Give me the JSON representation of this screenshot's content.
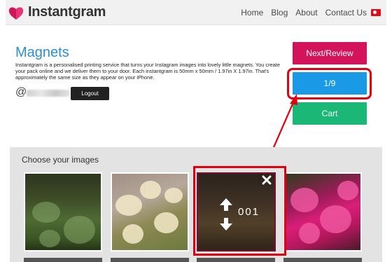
{
  "header": {
    "brand": "Instantgram",
    "nav": [
      "Home",
      "Blog",
      "About",
      "Contact Us"
    ],
    "flag_icon": "turkey-flag-icon"
  },
  "intro": {
    "title": "Magnets",
    "description": "Instantgram is a personalised printing service that turns your Instagram images into lovely little magnets. You create your pack online and we deliver them to your door. Each instantgram is 50mm x 50mm / 1.97in X 1.97in. That's approximately the same size as they appear on your iPhone.",
    "at_symbol": "@",
    "logout_label": "Logout"
  },
  "actions": {
    "next_label": "Next/Review",
    "count_label": "1/9",
    "cart_label": "Cart"
  },
  "gallery": {
    "title": "Choose your images",
    "selected_counter": "001"
  },
  "colors": {
    "brand_pink": "#d3145a",
    "blue": "#1a9ae6",
    "green": "#1bb776",
    "title_blue": "#2a8fd3",
    "highlight_red": "#e3000f"
  }
}
